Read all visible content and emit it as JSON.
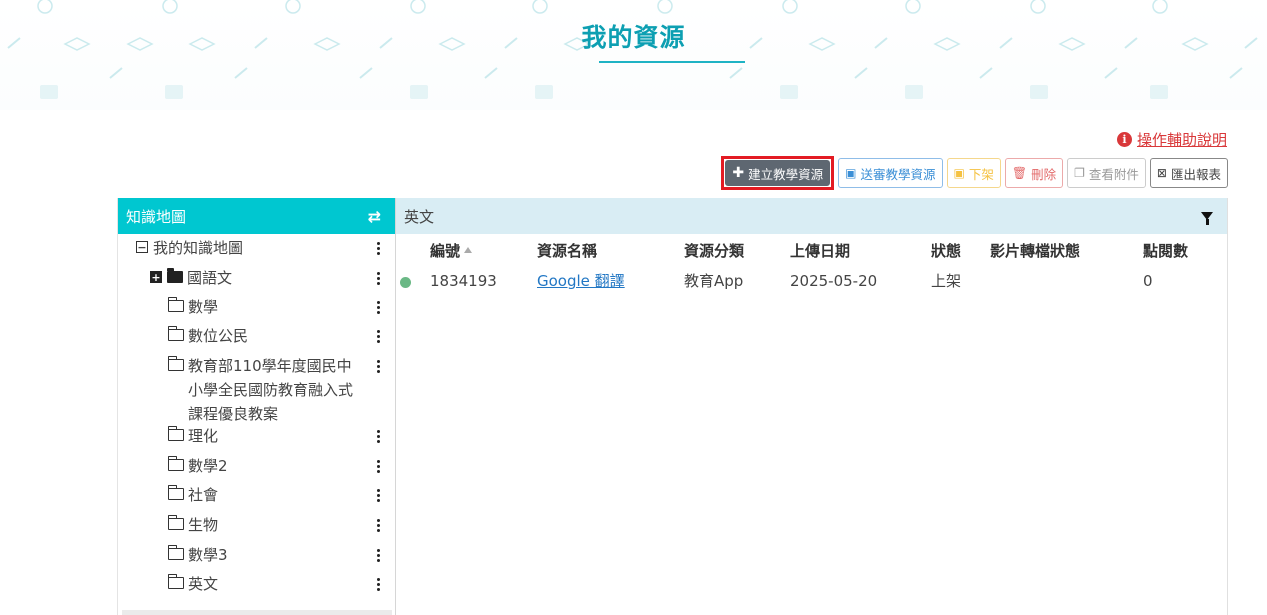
{
  "page": {
    "title": "我的資源"
  },
  "help": {
    "label": "操作輔助說明"
  },
  "toolbar": {
    "create": "建立教學資源",
    "submit": "送審教學資源",
    "off_shelf": "下架",
    "delete": "刪除",
    "attachments": "查看附件",
    "export": "匯出報表"
  },
  "sidebar": {
    "title": "知識地圖",
    "root": "我的知識地圖",
    "items": [
      {
        "label": "國語文"
      },
      {
        "label": "數學"
      },
      {
        "label": "數位公民"
      },
      {
        "label": "教育部110學年度國民中小學全民國防教育融入式課程優良教案"
      },
      {
        "label": "理化"
      },
      {
        "label": "數學2"
      },
      {
        "label": "社會"
      },
      {
        "label": "生物"
      },
      {
        "label": "數學3"
      },
      {
        "label": "英文"
      }
    ]
  },
  "main": {
    "header": "英文",
    "columns": [
      "編號",
      "資源名稱",
      "資源分類",
      "上傳日期",
      "狀態",
      "影片轉檔狀態",
      "點閱數"
    ],
    "rows": [
      {
        "id": "1834193",
        "name": "Google 翻譯",
        "category": "教育App",
        "date": "2025-05-20",
        "status": "上架",
        "video_status": "",
        "views": "0"
      }
    ]
  },
  "colors": {
    "accent": "#00c7d0",
    "title": "#0d9fb2",
    "highlight": "#e31b23",
    "link": "#2277c4",
    "status_dot": "#6ab885"
  }
}
